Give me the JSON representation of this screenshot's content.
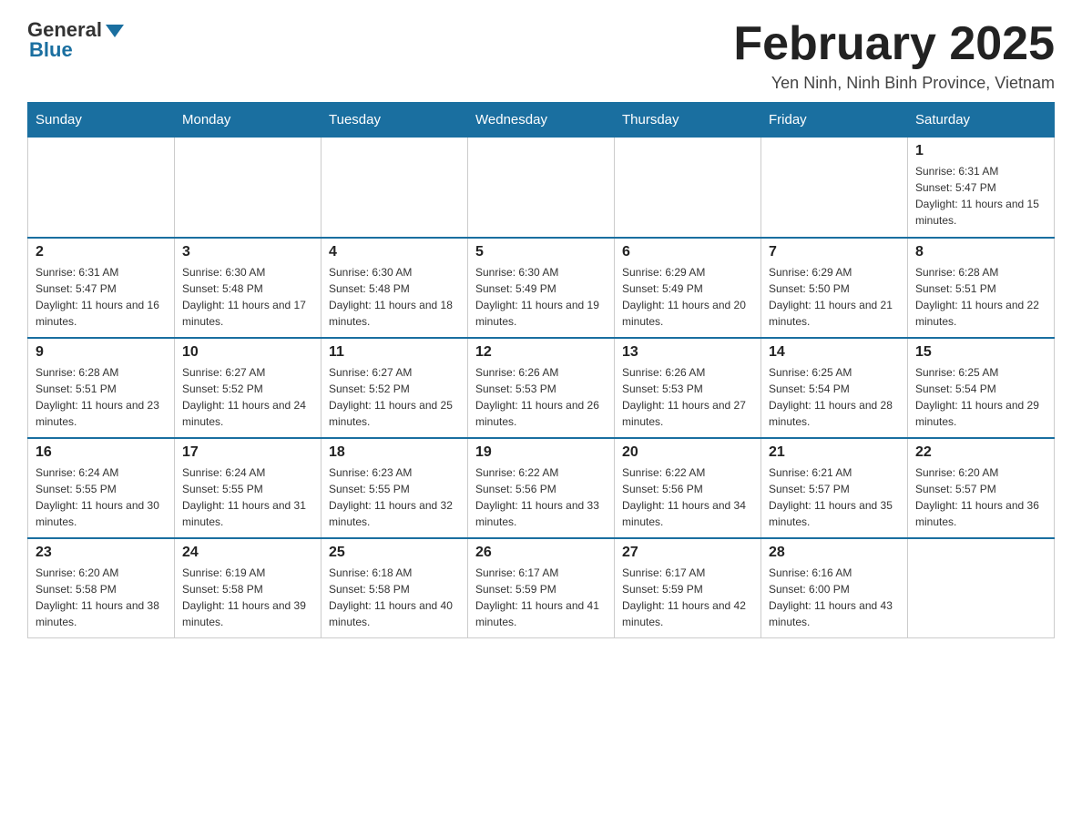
{
  "header": {
    "logo_general": "General",
    "logo_blue": "Blue",
    "month_title": "February 2025",
    "location": "Yen Ninh, Ninh Binh Province, Vietnam"
  },
  "days_of_week": [
    "Sunday",
    "Monday",
    "Tuesday",
    "Wednesday",
    "Thursday",
    "Friday",
    "Saturday"
  ],
  "weeks": [
    [
      {
        "day": "",
        "sunrise": "",
        "sunset": "",
        "daylight": ""
      },
      {
        "day": "",
        "sunrise": "",
        "sunset": "",
        "daylight": ""
      },
      {
        "day": "",
        "sunrise": "",
        "sunset": "",
        "daylight": ""
      },
      {
        "day": "",
        "sunrise": "",
        "sunset": "",
        "daylight": ""
      },
      {
        "day": "",
        "sunrise": "",
        "sunset": "",
        "daylight": ""
      },
      {
        "day": "",
        "sunrise": "",
        "sunset": "",
        "daylight": ""
      },
      {
        "day": "1",
        "sunrise": "Sunrise: 6:31 AM",
        "sunset": "Sunset: 5:47 PM",
        "daylight": "Daylight: 11 hours and 15 minutes."
      }
    ],
    [
      {
        "day": "2",
        "sunrise": "Sunrise: 6:31 AM",
        "sunset": "Sunset: 5:47 PM",
        "daylight": "Daylight: 11 hours and 16 minutes."
      },
      {
        "day": "3",
        "sunrise": "Sunrise: 6:30 AM",
        "sunset": "Sunset: 5:48 PM",
        "daylight": "Daylight: 11 hours and 17 minutes."
      },
      {
        "day": "4",
        "sunrise": "Sunrise: 6:30 AM",
        "sunset": "Sunset: 5:48 PM",
        "daylight": "Daylight: 11 hours and 18 minutes."
      },
      {
        "day": "5",
        "sunrise": "Sunrise: 6:30 AM",
        "sunset": "Sunset: 5:49 PM",
        "daylight": "Daylight: 11 hours and 19 minutes."
      },
      {
        "day": "6",
        "sunrise": "Sunrise: 6:29 AM",
        "sunset": "Sunset: 5:49 PM",
        "daylight": "Daylight: 11 hours and 20 minutes."
      },
      {
        "day": "7",
        "sunrise": "Sunrise: 6:29 AM",
        "sunset": "Sunset: 5:50 PM",
        "daylight": "Daylight: 11 hours and 21 minutes."
      },
      {
        "day": "8",
        "sunrise": "Sunrise: 6:28 AM",
        "sunset": "Sunset: 5:51 PM",
        "daylight": "Daylight: 11 hours and 22 minutes."
      }
    ],
    [
      {
        "day": "9",
        "sunrise": "Sunrise: 6:28 AM",
        "sunset": "Sunset: 5:51 PM",
        "daylight": "Daylight: 11 hours and 23 minutes."
      },
      {
        "day": "10",
        "sunrise": "Sunrise: 6:27 AM",
        "sunset": "Sunset: 5:52 PM",
        "daylight": "Daylight: 11 hours and 24 minutes."
      },
      {
        "day": "11",
        "sunrise": "Sunrise: 6:27 AM",
        "sunset": "Sunset: 5:52 PM",
        "daylight": "Daylight: 11 hours and 25 minutes."
      },
      {
        "day": "12",
        "sunrise": "Sunrise: 6:26 AM",
        "sunset": "Sunset: 5:53 PM",
        "daylight": "Daylight: 11 hours and 26 minutes."
      },
      {
        "day": "13",
        "sunrise": "Sunrise: 6:26 AM",
        "sunset": "Sunset: 5:53 PM",
        "daylight": "Daylight: 11 hours and 27 minutes."
      },
      {
        "day": "14",
        "sunrise": "Sunrise: 6:25 AM",
        "sunset": "Sunset: 5:54 PM",
        "daylight": "Daylight: 11 hours and 28 minutes."
      },
      {
        "day": "15",
        "sunrise": "Sunrise: 6:25 AM",
        "sunset": "Sunset: 5:54 PM",
        "daylight": "Daylight: 11 hours and 29 minutes."
      }
    ],
    [
      {
        "day": "16",
        "sunrise": "Sunrise: 6:24 AM",
        "sunset": "Sunset: 5:55 PM",
        "daylight": "Daylight: 11 hours and 30 minutes."
      },
      {
        "day": "17",
        "sunrise": "Sunrise: 6:24 AM",
        "sunset": "Sunset: 5:55 PM",
        "daylight": "Daylight: 11 hours and 31 minutes."
      },
      {
        "day": "18",
        "sunrise": "Sunrise: 6:23 AM",
        "sunset": "Sunset: 5:55 PM",
        "daylight": "Daylight: 11 hours and 32 minutes."
      },
      {
        "day": "19",
        "sunrise": "Sunrise: 6:22 AM",
        "sunset": "Sunset: 5:56 PM",
        "daylight": "Daylight: 11 hours and 33 minutes."
      },
      {
        "day": "20",
        "sunrise": "Sunrise: 6:22 AM",
        "sunset": "Sunset: 5:56 PM",
        "daylight": "Daylight: 11 hours and 34 minutes."
      },
      {
        "day": "21",
        "sunrise": "Sunrise: 6:21 AM",
        "sunset": "Sunset: 5:57 PM",
        "daylight": "Daylight: 11 hours and 35 minutes."
      },
      {
        "day": "22",
        "sunrise": "Sunrise: 6:20 AM",
        "sunset": "Sunset: 5:57 PM",
        "daylight": "Daylight: 11 hours and 36 minutes."
      }
    ],
    [
      {
        "day": "23",
        "sunrise": "Sunrise: 6:20 AM",
        "sunset": "Sunset: 5:58 PM",
        "daylight": "Daylight: 11 hours and 38 minutes."
      },
      {
        "day": "24",
        "sunrise": "Sunrise: 6:19 AM",
        "sunset": "Sunset: 5:58 PM",
        "daylight": "Daylight: 11 hours and 39 minutes."
      },
      {
        "day": "25",
        "sunrise": "Sunrise: 6:18 AM",
        "sunset": "Sunset: 5:58 PM",
        "daylight": "Daylight: 11 hours and 40 minutes."
      },
      {
        "day": "26",
        "sunrise": "Sunrise: 6:17 AM",
        "sunset": "Sunset: 5:59 PM",
        "daylight": "Daylight: 11 hours and 41 minutes."
      },
      {
        "day": "27",
        "sunrise": "Sunrise: 6:17 AM",
        "sunset": "Sunset: 5:59 PM",
        "daylight": "Daylight: 11 hours and 42 minutes."
      },
      {
        "day": "28",
        "sunrise": "Sunrise: 6:16 AM",
        "sunset": "Sunset: 6:00 PM",
        "daylight": "Daylight: 11 hours and 43 minutes."
      },
      {
        "day": "",
        "sunrise": "",
        "sunset": "",
        "daylight": ""
      }
    ]
  ]
}
